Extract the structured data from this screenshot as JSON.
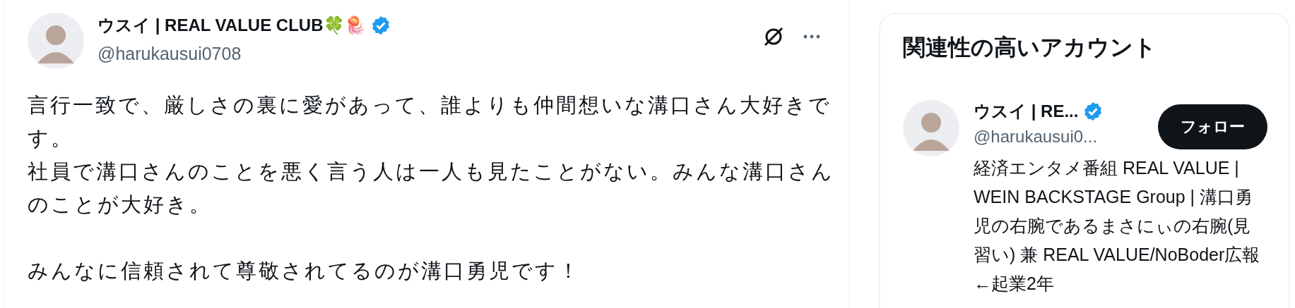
{
  "post": {
    "author": {
      "name": "ウスイ | REAL VALUE CLUB🍀🪼",
      "verified": true,
      "handle": "@harukausui0708"
    },
    "paragraphs": [
      "言行一致で、厳しさの裏に愛があって、誰よりも仲間想いな溝口さん大好きです。",
      "社員で溝口さんのことを悪く言う人は一人も見たことがない。みんな溝口さんのことが大好き。",
      "みんなに信頼されて尊敬されてるのが溝口勇児です！"
    ]
  },
  "sidebar": {
    "title": "関連性の高いアカウント",
    "accounts": [
      {
        "name": "ウスイ | RE...",
        "verified": true,
        "handle": "@harukausui0...",
        "button": "フォロー",
        "bio": "経済エンタメ番組 REAL VALUE | WEIN BACKSTAGE Group | 溝口勇児の右腕であるまさにぃの右腕(見習い) 兼 REAL VALUE/NoBoder広報 ←起業2年"
      }
    ]
  }
}
